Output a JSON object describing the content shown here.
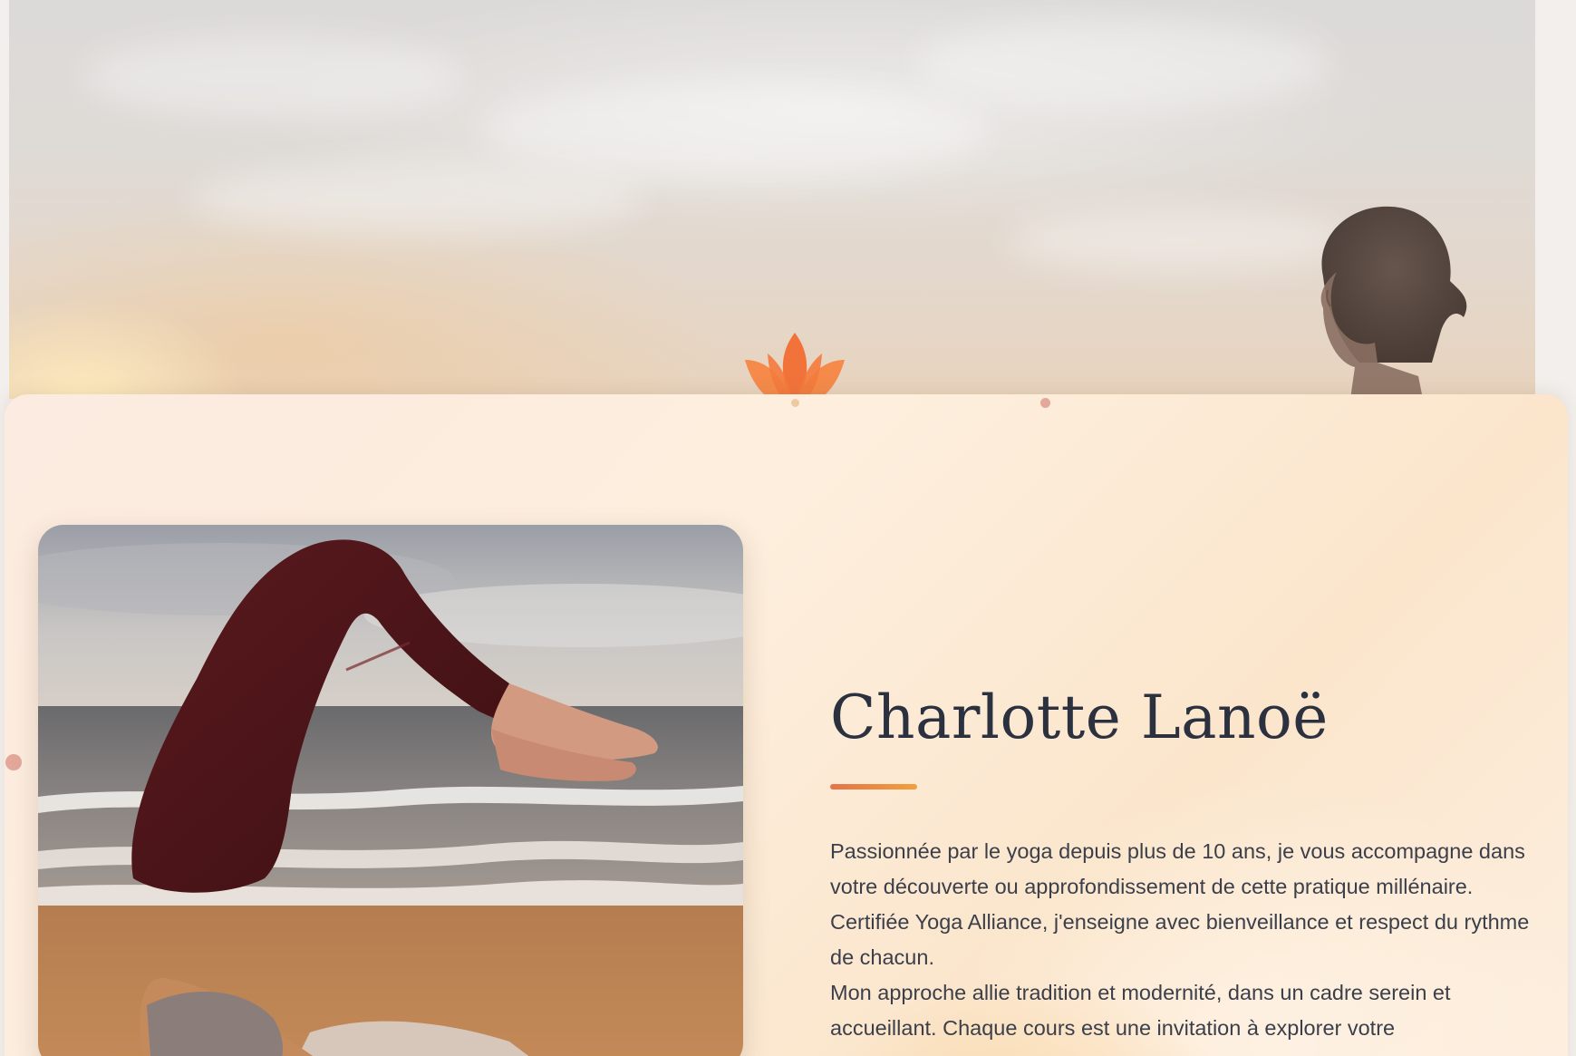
{
  "about": {
    "name": "Charlotte Lanoë",
    "paragraph1": "Passionnée par le yoga depuis plus de 10 ans, je vous accompagne dans votre découverte ou approfondissement de cette pratique millénaire. Certifiée Yoga Alliance, j'enseigne avec bienveillance et respect du rythme de chacun.",
    "paragraph2": "Mon approche allie tradition et modernité, dans un cadre serein et accueillant. Chaque cours est une invitation à explorer votre"
  },
  "colors": {
    "accent_orange": "#f2733a",
    "accent_gradient_start": "#e4734a",
    "accent_gradient_end": "#f2a03c",
    "heading": "#2c3140",
    "body_text": "#3b3f4a",
    "card_background": "#fdeedd"
  },
  "icons": {
    "hero_logo": "lotus-icon"
  }
}
